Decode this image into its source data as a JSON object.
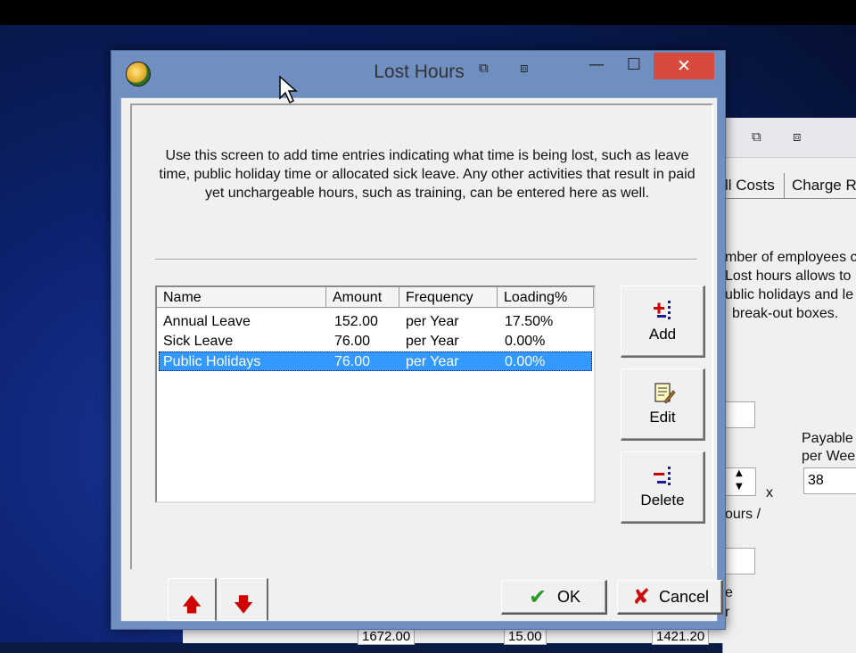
{
  "dialog": {
    "title": "Lost Hours",
    "close_glyph": "✕",
    "minimize_glyph": "—",
    "maximize_glyph": "☐",
    "description": "Use this screen to add time entries indicating what time is being lost, such as leave time, public holiday time or allocated sick leave.  Any other activities that result in paid yet unchargeable hours, such as training, can be entered here as well.",
    "columns": [
      "Name",
      "Amount",
      "Frequency",
      "Loading%"
    ],
    "rows": [
      {
        "name": "Annual Leave",
        "amount": "152.00",
        "frequency": "per Year",
        "loading": "17.50%"
      },
      {
        "name": "Sick Leave",
        "amount": "76.00",
        "frequency": "per Year",
        "loading": "0.00%"
      },
      {
        "name": "Public Holidays",
        "amount": "76.00",
        "frequency": "per Year",
        "loading": "0.00%"
      }
    ],
    "selected_row": 2,
    "buttons": {
      "add": "Add",
      "edit": "Edit",
      "delete": "Delete",
      "ok": "OK",
      "cancel": "Cancel"
    },
    "icons": {
      "app": "app-logo-icon",
      "add": "add-entry-icon",
      "edit": "edit-entry-icon",
      "delete": "delete-entry-icon",
      "move_up": "arrow-up-icon",
      "move_down": "arrow-down-icon",
      "ok": "checkmark-icon",
      "cancel": "x-mark-icon"
    }
  },
  "background_window": {
    "tabs": [
      "ll Costs",
      "Charge R"
    ],
    "text_lines": [
      "mber of employees c",
      "Lost hours allows to",
      "ublic holidays and le",
      "break-out boxes."
    ],
    "payable_label": "Payable\nper Wee",
    "payable_value": "38",
    "hours_label": "ours /",
    "x_label": "x",
    "e_label": "e",
    "r_label": "r",
    "bottom_values": [
      "1672.00",
      "15.00",
      "1421.20"
    ]
  },
  "colors": {
    "selection": "#3399ff",
    "close_button": "#d94a3e",
    "title_frame": "#6e8fc0",
    "arrow_red": "#d00000",
    "ok_green": "#2a9a2a",
    "cancel_red": "#cc1010"
  }
}
